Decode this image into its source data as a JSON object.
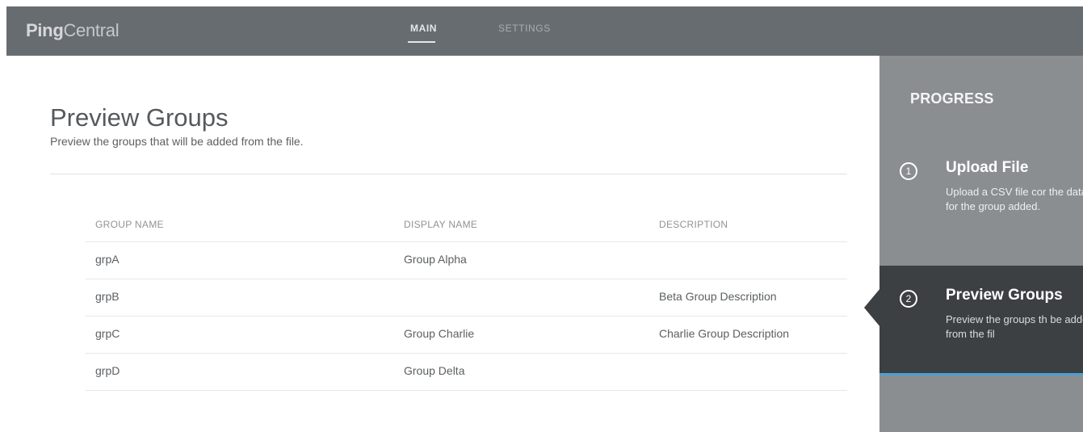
{
  "app": {
    "logo_bold": "Ping",
    "logo_regular": "Central"
  },
  "nav": {
    "tabs": [
      {
        "label": "MAIN",
        "active": true
      },
      {
        "label": "SETTINGS",
        "active": false
      }
    ]
  },
  "main": {
    "title": "Preview Groups",
    "subtitle": "Preview the groups that will be added from the file.",
    "table": {
      "headers": [
        "GROUP NAME",
        "DISPLAY NAME",
        "DESCRIPTION"
      ],
      "rows": [
        {
          "group_name": "grpA",
          "display_name": "Group Alpha",
          "description": ""
        },
        {
          "group_name": "grpB",
          "display_name": "",
          "description": "Beta Group Description"
        },
        {
          "group_name": "grpC",
          "display_name": "Group Charlie",
          "description": "Charlie Group Description"
        },
        {
          "group_name": "grpD",
          "display_name": "Group Delta",
          "description": ""
        }
      ]
    }
  },
  "progress": {
    "title": "PROGRESS",
    "steps": [
      {
        "number": "1",
        "title": "Upload File",
        "description": "Upload a CSV file cor the data for the group added.",
        "active": false
      },
      {
        "number": "2",
        "title": "Preview Groups",
        "description": "Preview the groups th be added from the fil",
        "active": true
      }
    ]
  },
  "colors": {
    "topbar": "#676c70",
    "panel": "#8a8e91",
    "active_step": "#3d4043",
    "accent": "#4aa0d6"
  }
}
